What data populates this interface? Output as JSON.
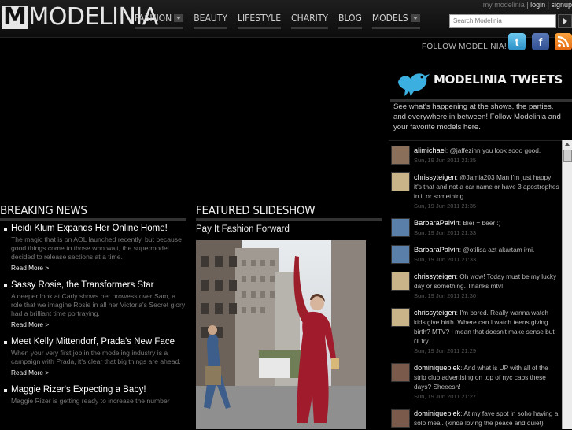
{
  "header": {
    "logo_mark": "M",
    "logo_text": "MODELINIA",
    "nav": [
      {
        "label": "FASHION",
        "dropdown": true
      },
      {
        "label": "BEAUTY",
        "dropdown": false
      },
      {
        "label": "LIFESTYLE",
        "dropdown": false
      },
      {
        "label": "CHARITY",
        "dropdown": false
      },
      {
        "label": "BLOG",
        "dropdown": false
      },
      {
        "label": "MODELS",
        "dropdown": true
      }
    ],
    "util": {
      "my": "my modelinia",
      "login": "login",
      "signup": "signup"
    },
    "search_placeholder": "Search Modelinia"
  },
  "follow": {
    "label": "FOLLOW MODELINIA!",
    "icons": [
      "twitter-icon",
      "facebook-icon",
      "rss-icon"
    ]
  },
  "tweets": {
    "title": "MODELINIA TWEETS",
    "intro": "See what's happening at the shows, the parties, and everywhere in between! Follow Modelinia and your favorite models here.",
    "items": [
      {
        "user": "alimichael",
        "text": ": @jaffezinn you look sooo good.",
        "time": "Sun, 19 Jun 2011 21:35",
        "color": "#8a6f5a"
      },
      {
        "user": "chrissyteigen",
        "text": ": @Jamia203 Man I'm just happy it's that and not a car name or have 3 apostrophes in it or something.",
        "time": "Sun, 19 Jun 2011 21:35",
        "color": "#c9b48a"
      },
      {
        "user": "BarbaraPalvin",
        "text": ": Bier = beer :)",
        "time": "Sun, 19 Jun 2011 21:33",
        "color": "#5a7fa8"
      },
      {
        "user": "BarbaraPalvin",
        "text": ": @otilisa azt akartam irni.",
        "time": "Sun, 19 Jun 2011 21:33",
        "color": "#5a7fa8"
      },
      {
        "user": "chrissyteigen",
        "text": ": Oh wow! Today must be my lucky day or something. Thanks mtv!",
        "time": "Sun, 19 Jun 2011 21:30",
        "color": "#c9b48a"
      },
      {
        "user": "chrissyteigen",
        "text": ": I'm bored. Really wanna watch kids give birth. Where can I watch teens giving birth? MTV? I mean that doesn't make sense but i'll try.",
        "time": "Sun, 19 Jun 2011 21:29",
        "color": "#c9b48a"
      },
      {
        "user": "dominiquepiek",
        "text": ": And what is UP with all of the strip club advertising on top of nyc cabs these days? Sheeesh!",
        "time": "Sun, 19 Jun 2011 21:27",
        "color": "#7a5a4a"
      },
      {
        "user": "dominiquepiek",
        "text": ": At my fave spot in soho having a solo meal. (kinda loving the peace and quiet)",
        "time": "Sun, 19 Jun 2011 21:25",
        "color": "#7a5a4a"
      }
    ]
  },
  "breaking": {
    "title": "BREAKING NEWS",
    "items": [
      {
        "headline": "Heidi Klum Expands Her Online Home!",
        "teaser": "The magic that is on AOL launched recently, but because good things come to those who wait, the supermodel decided to release sections at a time.",
        "more": "Read More >"
      },
      {
        "headline": "Sassy Rosie, the Transformers Star",
        "teaser": "A deeper look at Carly shows her prowess over Sam, a role that we imagine Rosie in all her Victoria's Secret glory had a brilliant time portraying.",
        "more": "Read More >"
      },
      {
        "headline": "Meet Kelly Mittendorf, Prada's New Face",
        "teaser": "When your very first job in the modeling industry is a campaign with Prada, it's clear that big things are ahead.",
        "more": "Read More >"
      },
      {
        "headline": "Maggie Rizer's Expecting a Baby!",
        "teaser": "Maggie Rizer is getting ready to increase the number",
        "more": ""
      }
    ]
  },
  "featured": {
    "title": "FEATURED SLIDESHOW",
    "slide_title": "Pay It Fashion Forward"
  }
}
